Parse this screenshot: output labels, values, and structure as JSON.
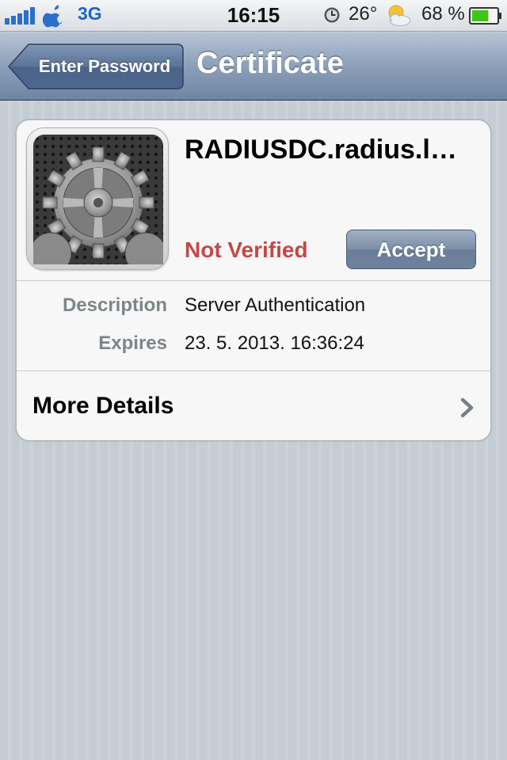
{
  "status_bar": {
    "network": "3G",
    "time": "16:15",
    "temperature": "26°",
    "battery_percent": "68 %",
    "icons": [
      "signal-bars-icon",
      "apple-icon",
      "alarm-clock-icon",
      "weather-partly-cloudy-icon",
      "battery-icon"
    ],
    "battery_color": "#3fc419",
    "network_color": "#2166c0"
  },
  "nav": {
    "back_label": "Enter Password",
    "title": "Certificate"
  },
  "certificate": {
    "name": "RADIUSDC.radius.l…",
    "status": "Not Verified",
    "status_color": "#c44848",
    "accept_label": "Accept",
    "icon": "settings-gear-icon",
    "details": [
      {
        "label": "Description",
        "value": "Server Authentication"
      },
      {
        "label": "Expires",
        "value": "23. 5. 2013. 16:36:24"
      }
    ],
    "more_details_label": "More Details"
  }
}
